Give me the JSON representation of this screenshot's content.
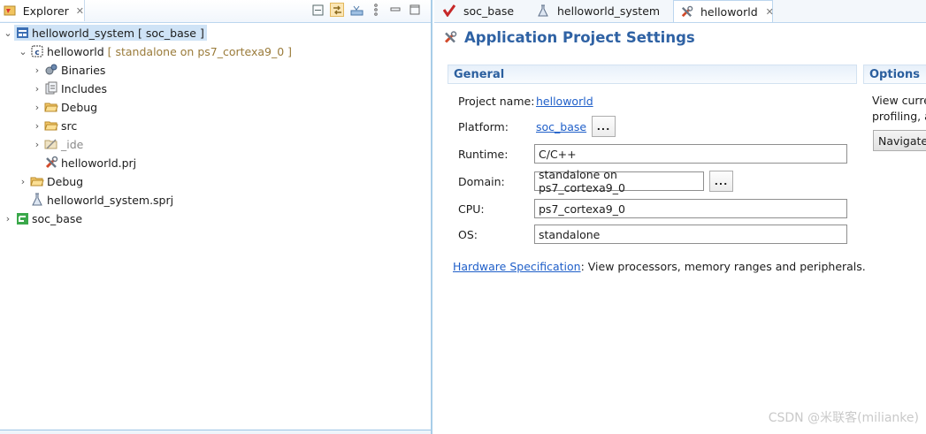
{
  "explorer": {
    "tab_label": "Explorer",
    "close_glyph": "✕",
    "tree": [
      {
        "label": "helloworld_system [ soc_base ]",
        "decoration": "",
        "icon": "system-project-icon",
        "expand": "open"
      },
      {
        "label": "helloworld",
        "decoration": "[ standalone on ps7_cortexa9_0 ]",
        "icon": "c-project-icon",
        "expand": "open"
      },
      {
        "label": "Binaries",
        "decoration": "",
        "icon": "binaries-icon",
        "expand": "closed"
      },
      {
        "label": "Includes",
        "decoration": "",
        "icon": "includes-icon",
        "expand": "closed"
      },
      {
        "label": "Debug",
        "decoration": "",
        "icon": "folder-icon",
        "expand": "closed"
      },
      {
        "label": "src",
        "decoration": "",
        "icon": "folder-icon",
        "expand": "closed"
      },
      {
        "label": "_ide",
        "decoration": "",
        "icon": "ide-folder-icon",
        "expand": "closed"
      },
      {
        "label": "helloworld.prj",
        "decoration": "",
        "icon": "project-settings-icon",
        "expand": "none"
      },
      {
        "label": "Debug",
        "decoration": "",
        "icon": "folder-icon",
        "expand": "closed"
      },
      {
        "label": "helloworld_system.sprj",
        "decoration": "",
        "icon": "system-settings-icon",
        "expand": "none"
      },
      {
        "label": "soc_base",
        "decoration": "",
        "icon": "platform-icon",
        "expand": "closed"
      }
    ]
  },
  "editor": {
    "tabs": [
      {
        "label": "soc_base",
        "icon": "platform-editor-icon",
        "active": false
      },
      {
        "label": "helloworld_system",
        "icon": "system-editor-icon",
        "active": false
      },
      {
        "label": "helloworld",
        "icon": "app-editor-icon",
        "active": true
      }
    ],
    "title": "Application Project Settings",
    "general": {
      "heading": "General",
      "project_name_label": "Project name:",
      "project_name_value": "helloworld",
      "platform_label": "Platform:",
      "platform_value": "soc_base",
      "browse_label": "...",
      "runtime_label": "Runtime:",
      "runtime_value": "C/C++",
      "domain_label": "Domain:",
      "domain_value": "standalone on ps7_cortexa9_0",
      "cpu_label": "CPU:",
      "cpu_value": "ps7_cortexa9_0",
      "os_label": "OS:",
      "os_value": "standalone",
      "hw_spec_link": "Hardware Specification",
      "hw_spec_text": ": View processors, memory ranges and peripherals."
    },
    "options": {
      "heading": "Options",
      "text_line1": "View curre",
      "text_line2": "profiling, a",
      "navigate_label": "Navigate"
    }
  },
  "watermark": "CSDN @米联客(milianke)"
}
